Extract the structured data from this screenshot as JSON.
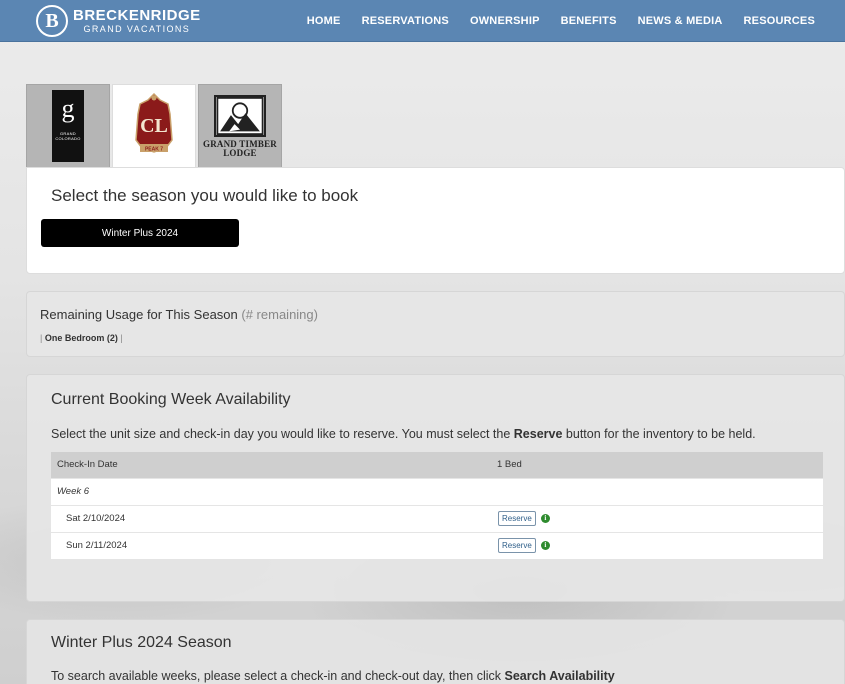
{
  "brand": {
    "logo_letter": "B",
    "name": "BRECKENRIDGE",
    "sub": "GRAND VACATIONS"
  },
  "nav": {
    "items": [
      "HOME",
      "RESERVATIONS",
      "OWNERSHIP",
      "BENEFITS",
      "NEWS & MEDIA",
      "RESOURCES"
    ]
  },
  "resort_tabs": [
    {
      "name": "Grand Colorado",
      "logo_letter": "g",
      "logo_text": "GRAND COLORADO"
    },
    {
      "name": "Peak 7",
      "logo_text": "PEAK 7"
    },
    {
      "name": "Grand Timber Lodge",
      "logo_text": "GRAND TIMBER LODGE"
    }
  ],
  "season": {
    "title": "Select the season you would like to book",
    "button_label": "Winter Plus 2024"
  },
  "usage": {
    "title": "Remaining Usage for This Season",
    "title_suffix": "(# remaining)",
    "items": [
      "One Bedroom (2)"
    ]
  },
  "availability": {
    "title": "Current Booking Week Availability",
    "instruction_pre": "Select the unit size and check-in day you would like to reserve. You must select the",
    "instruction_bold": "Reserve",
    "instruction_post": "button for the inventory to be held.",
    "columns": [
      "Check-In Date",
      "1 Bed"
    ],
    "week_label": "Week 6",
    "rows": [
      {
        "date": "Sat 2/10/2024",
        "action": "Reserve"
      },
      {
        "date": "Sun 2/11/2024",
        "action": "Reserve"
      }
    ]
  },
  "winter": {
    "title": "Winter Plus 2024 Season",
    "instruction_pre": "To search available weeks, please select a check-in and check-out day, then click",
    "instruction_bold": "Search Availability"
  },
  "colors": {
    "header": "#5b86b3",
    "season_button": "#000000",
    "info_icon": "#2e8b2e"
  }
}
